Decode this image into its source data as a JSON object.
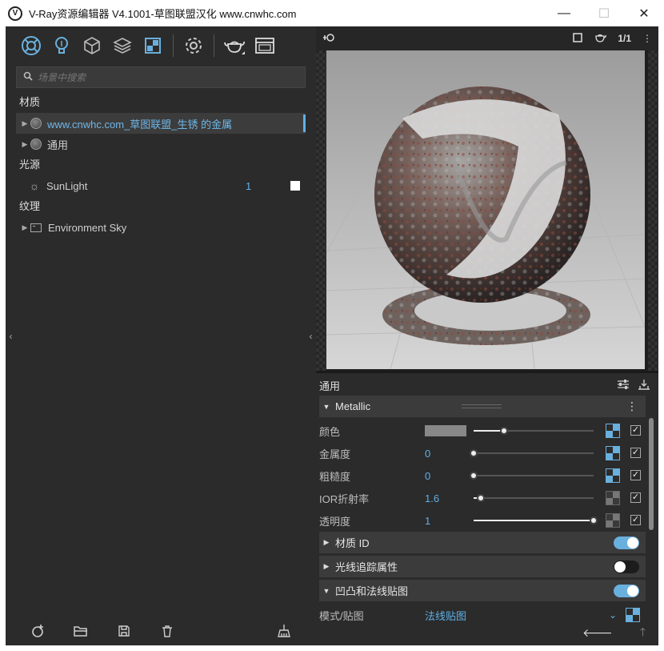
{
  "window": {
    "title": "V-Ray资源编辑器 V4.1001-草图联盟汉化 www.cnwhc.com",
    "logo_letter": "V",
    "minimize": "—",
    "maximize": "☐",
    "close": "✕"
  },
  "left": {
    "search_placeholder": "场景中搜索",
    "categories": {
      "materials": "材质",
      "lights": "光源",
      "textures": "纹理"
    },
    "materials": [
      {
        "label": "www.cnwhc.com_草图联盟_生锈 的金属",
        "selected": true
      },
      {
        "label": "通用",
        "selected": false
      }
    ],
    "lights": [
      {
        "label": "SunLight",
        "count": "1"
      }
    ],
    "textures": [
      {
        "label": "Environment Sky"
      }
    ],
    "collapse_glyph": "‹"
  },
  "right": {
    "preview_toolbar": {
      "ratio_label": "1/1"
    },
    "props_title": "通用",
    "sections": {
      "metallic": "Metallic",
      "material_id": "材质 ID",
      "raytrace": "光线追踪属性",
      "bump": "凹凸和法线贴图"
    },
    "params": [
      {
        "label": "颜色",
        "value": "",
        "slider": 0.25
      },
      {
        "label": "金属度",
        "value": "0",
        "slider": 0.0
      },
      {
        "label": "粗糙度",
        "value": "0",
        "slider": 0.0
      },
      {
        "label": "IOR折射率",
        "value": "1.6",
        "slider": 0.06
      },
      {
        "label": "透明度",
        "value": "1",
        "slider": 1.0
      }
    ],
    "toggles": {
      "material_id": true,
      "raytrace": false,
      "bump": true
    },
    "mode_row": {
      "label": "模式/贴图",
      "value": "法线贴图"
    }
  },
  "colors": {
    "accent": "#5fb0e6",
    "bg": "#2b2b2b",
    "color_swatch": "#888888"
  }
}
